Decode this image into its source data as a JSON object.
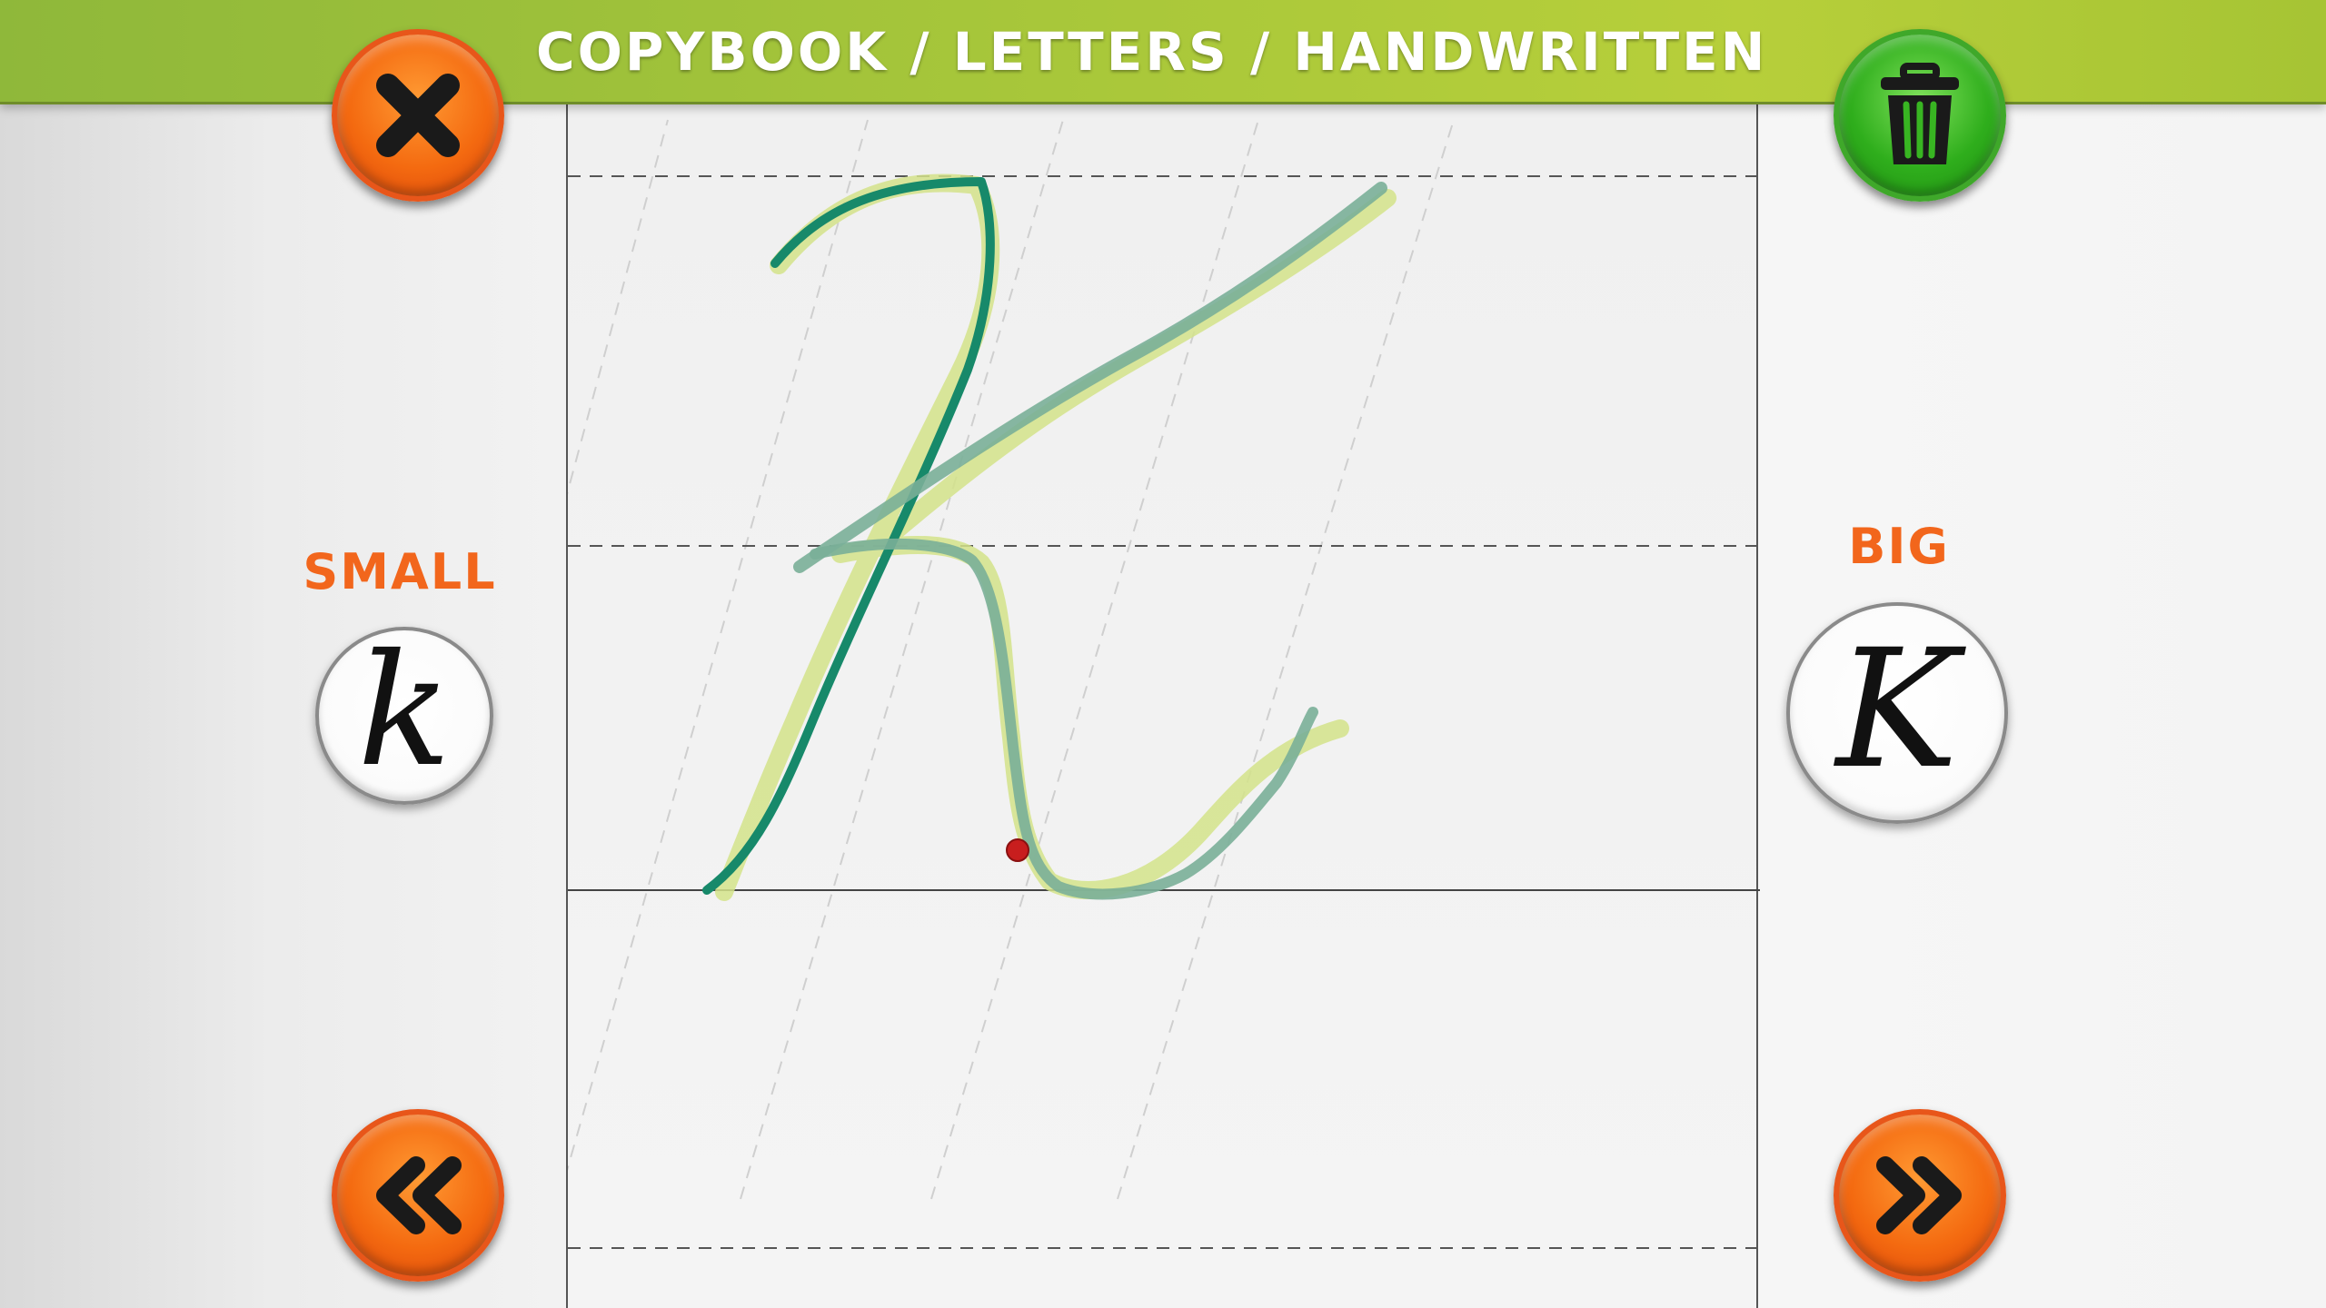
{
  "header": {
    "title": "COPYBOOK / LETTERS / HANDWRITTEN"
  },
  "buttons": {
    "close": {
      "icon": "close-icon"
    },
    "trash": {
      "icon": "trash-icon"
    },
    "previous": {
      "icon": "double-chevron-left-icon"
    },
    "next": {
      "icon": "double-chevron-right-icon"
    }
  },
  "letter_options": {
    "small": {
      "label": "SMALL",
      "glyph": "k"
    },
    "big": {
      "label": "BIG",
      "glyph": "K"
    }
  },
  "colors": {
    "header_green": "#a8c73a",
    "orange_button": "#f46a10",
    "green_button": "#2fae1c",
    "label_orange": "#f2661c",
    "user_stroke": "#17896a",
    "guide_stroke": "#d4e38a",
    "stroke_endpoint": "#c81e1e"
  }
}
